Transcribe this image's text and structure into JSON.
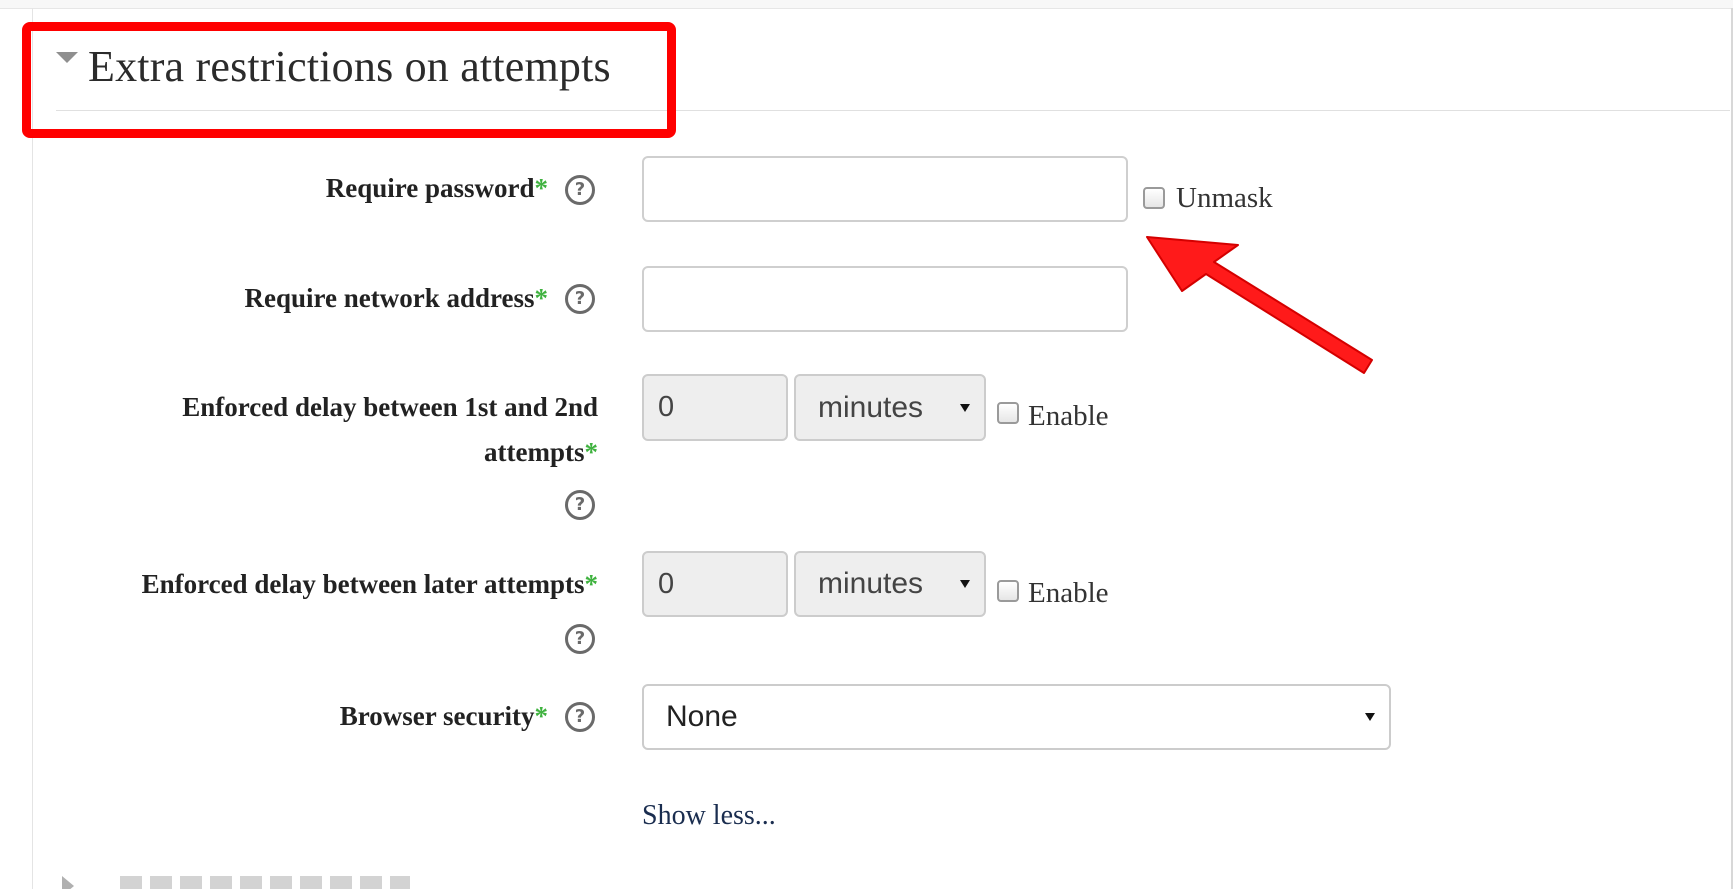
{
  "section": {
    "title": "Extra restrictions on attempts",
    "caret_icon": "caret-down-icon"
  },
  "fields": {
    "require_password": {
      "label": "Require password",
      "required_marker": "*",
      "value": "",
      "unmask_label": "Unmask"
    },
    "require_network": {
      "label": "Require network address",
      "required_marker": "*",
      "value": ""
    },
    "delay_first": {
      "label_line1": "Enforced delay between 1st and 2nd",
      "label_line2": "attempts",
      "required_marker": "*",
      "value": "0",
      "unit": "minutes",
      "enable_label": "Enable"
    },
    "delay_later": {
      "label": "Enforced delay between later attempts",
      "required_marker": "*",
      "value": "0",
      "unit": "minutes",
      "enable_label": "Enable"
    },
    "browser_security": {
      "label": "Browser security",
      "required_marker": "*",
      "value": "None"
    }
  },
  "help_glyph": "?",
  "show_less_label": "Show less...",
  "colors": {
    "required": "#3fb23f",
    "annotation": "#ff0000",
    "link": "#1a2d4f"
  }
}
